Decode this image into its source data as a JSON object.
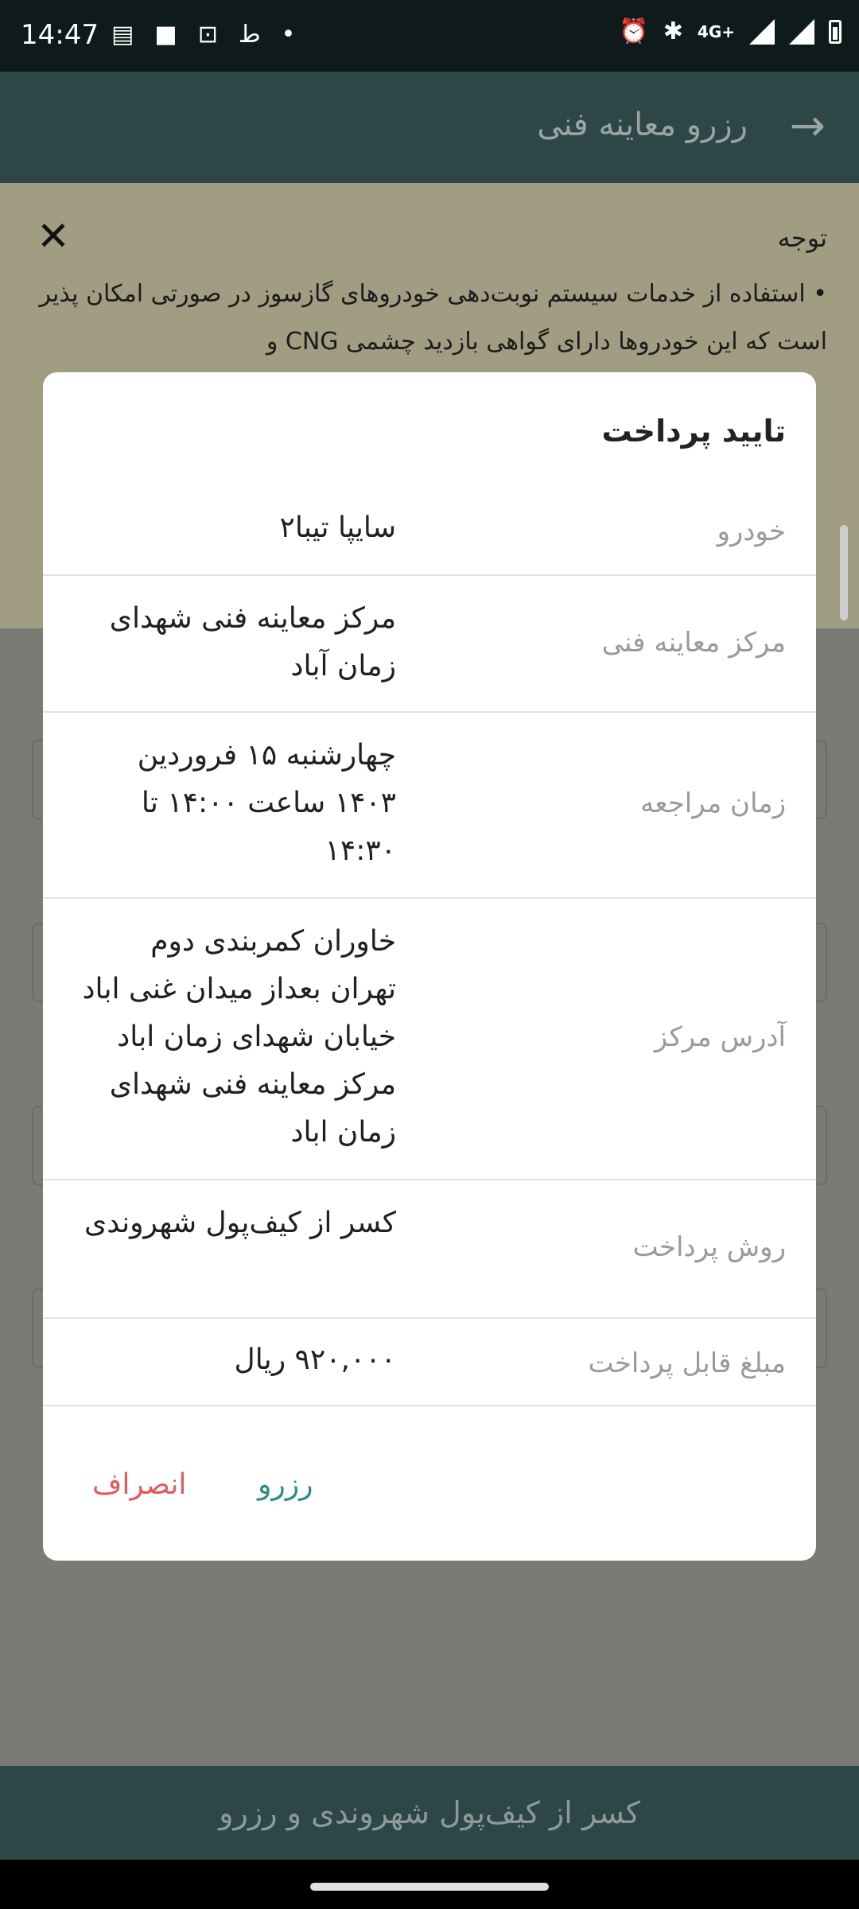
{
  "status_bar": {
    "time": "14:47",
    "network": "4G+"
  },
  "app_bar": {
    "title": "رزرو معاینه فنی"
  },
  "notice": {
    "title": "توجه",
    "text": "• استفاده از خدمات سیستم نوبت‌دهی خودروهای گازسوز در صورتی امکان پذیر است که این خودروها دارای گواهی بازدید چشمی CNG و"
  },
  "dialog": {
    "title": "تایید پرداخت",
    "rows": [
      {
        "label": "خودرو",
        "value": "سایپا تیبا۲"
      },
      {
        "label": "مرکز معاینه فنی",
        "value": "مرکز معاینه فنی شهدای زمان آباد"
      },
      {
        "label": "زمان مراجعه",
        "value": "چهارشنبه ۱۵ فروردین ۱۴۰۳ ساعت ۱۴:۰۰ تا ۱۴:۳۰"
      },
      {
        "label": "آدرس مرکز",
        "value": "خاوران کمربندی دوم تهران بعداز میدان غنی اباد خیابان شهدای زمان اباد مرکز معاینه فنی شهدای زمان اباد"
      },
      {
        "label": "روش پرداخت",
        "value": "کسر از کیف‌پول شهروندی"
      },
      {
        "label": "مبلغ قابل پرداخت",
        "value": "۹۲۰,۰۰۰ ریال"
      }
    ],
    "reserve_label": "رزرو",
    "cancel_label": "انصراف"
  },
  "bottom_button": {
    "label": "کسر از کیف‌پول شهروندی و رزرو"
  }
}
